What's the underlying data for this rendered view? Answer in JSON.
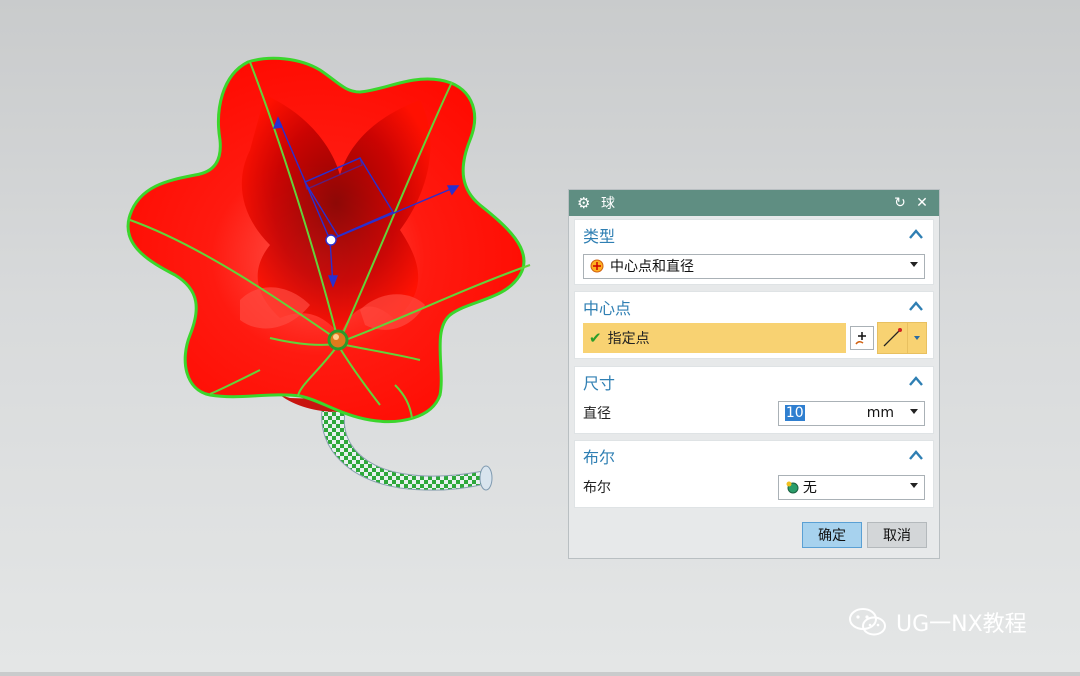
{
  "dialog": {
    "title": "球",
    "type_section": {
      "label": "类型",
      "selected": "中心点和直径"
    },
    "center_section": {
      "label": "中心点",
      "specify_label": "指定点"
    },
    "size_section": {
      "label": "尺寸",
      "diameter_label": "直径",
      "diameter_value": "10",
      "unit": "mm"
    },
    "boolean_section": {
      "label": "布尔",
      "boolean_label": "布尔",
      "selected": "无"
    },
    "ok_label": "确定",
    "cancel_label": "取消"
  },
  "watermark": {
    "text": "UG一NX教程"
  },
  "colors": {
    "title_bar": "#5f8e82",
    "section_label": "#2f7fb3",
    "specify_highlight": "#f8d272",
    "flower_red": "#ff1a10",
    "edge_green": "#39d12c"
  }
}
